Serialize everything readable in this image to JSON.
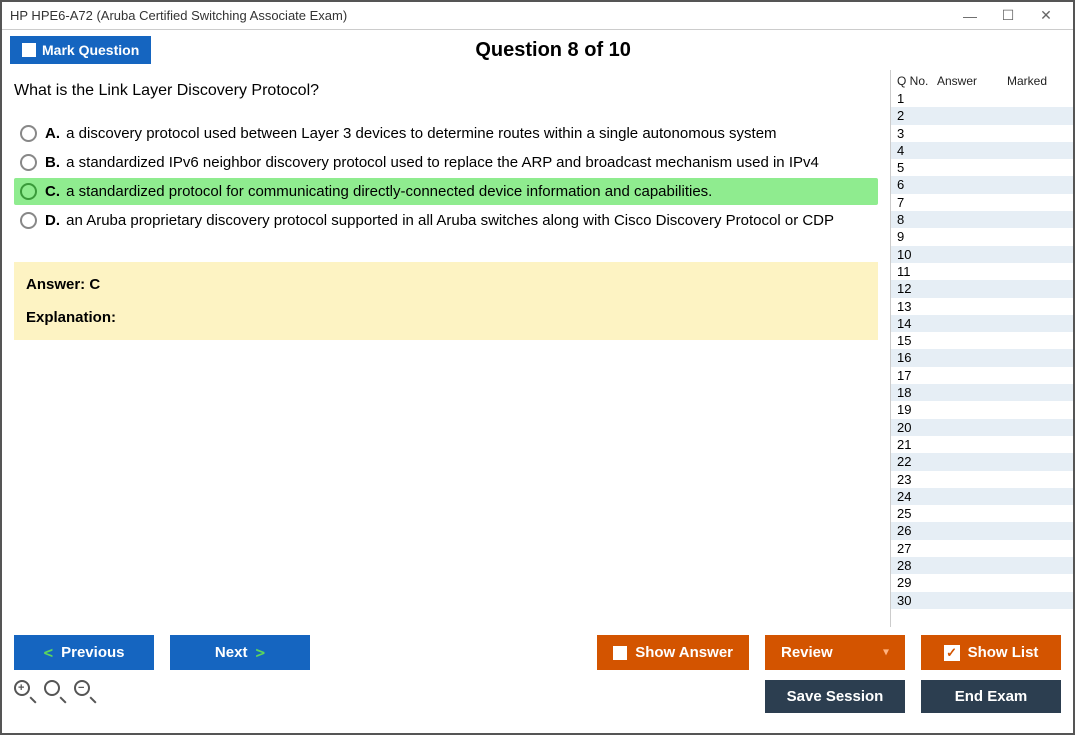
{
  "window": {
    "title": "HP HPE6-A72 (Aruba Certified Switching Associate Exam)"
  },
  "header": {
    "mark_label": "Mark Question",
    "question_title": "Question 8 of 10"
  },
  "question": {
    "text": "What is the Link Layer Discovery Protocol?",
    "choices": [
      {
        "letter": "A.",
        "text": "a discovery protocol used between Layer 3 devices to determine routes within a single autonomous system",
        "correct": false
      },
      {
        "letter": "B.",
        "text": "a standardized IPv6 neighbor discovery protocol used to replace the ARP and broadcast mechanism used in IPv4",
        "correct": false
      },
      {
        "letter": "C.",
        "text": "a standardized protocol for communicating directly-connected device information and capabilities.",
        "correct": true
      },
      {
        "letter": "D.",
        "text": "an Aruba proprietary discovery protocol supported in all Aruba switches along with Cisco Discovery Protocol or CDP",
        "correct": false
      }
    ],
    "answer_label": "Answer: C",
    "explanation_label": "Explanation:"
  },
  "sidebar": {
    "col_qno": "Q No.",
    "col_answer": "Answer",
    "col_marked": "Marked",
    "rows": [
      1,
      2,
      3,
      4,
      5,
      6,
      7,
      8,
      9,
      10,
      11,
      12,
      13,
      14,
      15,
      16,
      17,
      18,
      19,
      20,
      21,
      22,
      23,
      24,
      25,
      26,
      27,
      28,
      29,
      30
    ]
  },
  "footer": {
    "previous": "Previous",
    "next": "Next",
    "show_answer": "Show Answer",
    "review": "Review",
    "show_list": "Show List",
    "save_session": "Save Session",
    "end_exam": "End Exam"
  }
}
